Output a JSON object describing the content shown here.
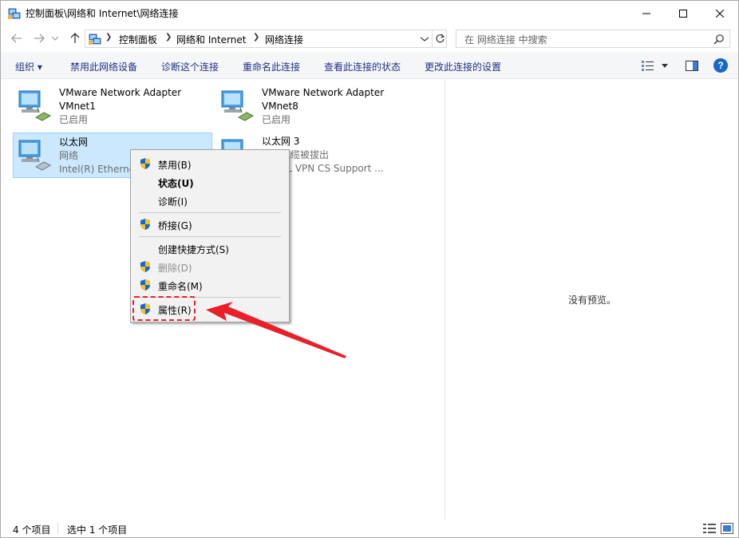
{
  "window": {
    "title": "控制面板\\网络和 Internet\\网络连接"
  },
  "address": {
    "crumbs": [
      "控制面板",
      "网络和 Internet",
      "网络连接"
    ],
    "search_placeholder": "在 网络连接 中搜索"
  },
  "commands": {
    "organize": "组织 ▾",
    "disable": "禁用此网络设备",
    "diagnose": "诊断这个连接",
    "rename": "重命名此连接",
    "status": "查看此连接的状态",
    "change_settings": "更改此连接的设置"
  },
  "adapters": [
    {
      "name": "VMware Network Adapter",
      "line1": "VMnet1",
      "line2": "已启用"
    },
    {
      "name": "VMware Network Adapter",
      "line1": "VMnet8",
      "line2": "已启用"
    },
    {
      "name": "以太网",
      "line1": "网络",
      "line2": "Intel(R) Ethernet"
    },
    {
      "name": "以太网 3",
      "line1": "网络电缆被拔出",
      "line2": "or SSL VPN CS Support ..."
    }
  ],
  "context_menu": {
    "disable": "禁用(B)",
    "status": "状态(U)",
    "diagnose": "诊断(I)",
    "bridge": "桥接(G)",
    "shortcut": "创建快捷方式(S)",
    "delete": "删除(D)",
    "rename": "重命名(M)",
    "properties": "属性(R)"
  },
  "preview": {
    "empty_text": "没有预览。"
  },
  "statusbar": {
    "item_count": "4 个项目",
    "selected_count": "选中 1 个项目"
  },
  "colors": {
    "accent": "#1e3287",
    "selection": "#cce8ff",
    "annotation": "#e8202a"
  }
}
